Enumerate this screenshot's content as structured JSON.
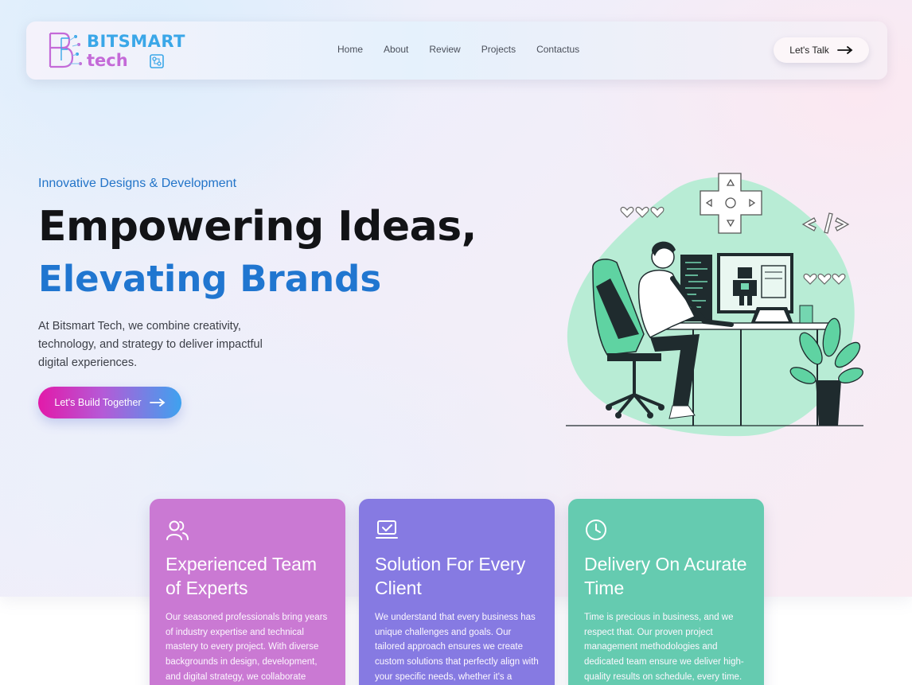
{
  "brand": {
    "line1": "BITSMART",
    "line2": "tech",
    "colors": {
      "blue": "#3aa7e8",
      "pink": "#c46ad8"
    }
  },
  "nav": {
    "links": [
      "Home",
      "About",
      "Review",
      "Projects",
      "Contactus"
    ],
    "cta_label": "Let's Talk"
  },
  "hero": {
    "kicker": "Innovative Designs & Development",
    "title_line1": "Empowering Ideas,",
    "title_line2": "Elevating Brands",
    "description": "At Bitsmart Tech, we combine creativity, technology, and strategy to deliver impactful digital experiences.",
    "cta_label": "Let's Build Together",
    "accent_color": "#2076d0"
  },
  "features": [
    {
      "icon": "users-icon",
      "title": "Experienced Team of Experts",
      "text": "Our seasoned professionals bring years of industry expertise and technical mastery to every project. With diverse backgrounds in design, development, and digital strategy, we collaborate",
      "color": "#ca79d3"
    },
    {
      "icon": "laptop-check-icon",
      "title": "Solution For Every Client",
      "text": "We understand that every business has unique challenges and goals. Our tailored approach ensures we create custom solutions that perfectly align with your specific needs, whether it's a",
      "color": "#867ae2"
    },
    {
      "icon": "clock-icon",
      "title": "Delivery On Acurate Time",
      "text": "Time is precious in business, and we respect that. Our proven project management methodologies and dedicated team ensure we deliver high-quality results on schedule, every time.",
      "color": "#65cbb0"
    }
  ]
}
